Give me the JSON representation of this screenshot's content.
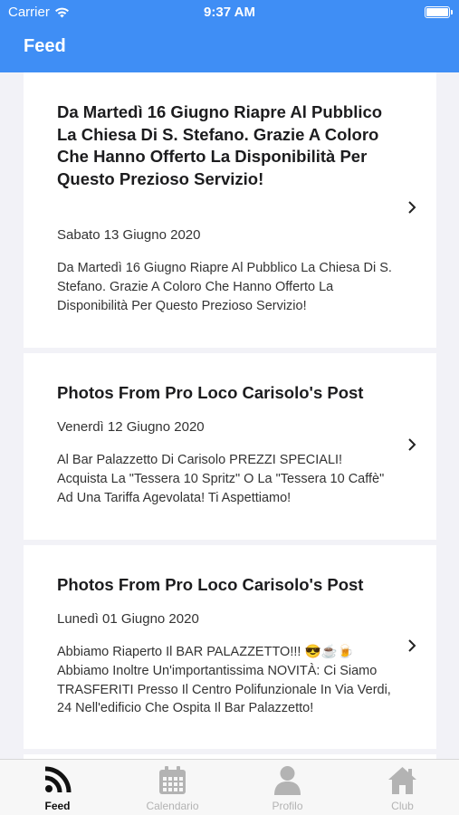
{
  "status_bar": {
    "carrier": "Carrier",
    "time": "9:37 AM"
  },
  "header": {
    "title": "Feed"
  },
  "feed": {
    "items": [
      {
        "title": "Da Martedì 16 Giugno Riapre Al Pubblico La Chiesa Di S. Stefano. Grazie A Coloro Che Hanno Offerto La Disponibilità Per Questo Prezioso Servizio!",
        "date": "Sabato 13 Giugno 2020",
        "text": "Da Martedì 16 Giugno Riapre Al Pubblico La Chiesa Di S. Stefano. Grazie A Coloro Che Hanno Offerto La Disponibilità Per Questo Prezioso Servizio!"
      },
      {
        "title": "Photos From Pro Loco Carisolo's Post",
        "date": "Venerdì 12 Giugno 2020",
        "text": "Al Bar Palazzetto Di Carisolo PREZZI SPECIALI! Acquista La \"Tessera 10 Spritz\" O La \"Tessera 10 Caffè\" Ad Una Tariffa Agevolata! Ti Aspettiamo!"
      },
      {
        "title": "Photos From Pro Loco Carisolo's Post",
        "date": "Lunedì 01 Giugno 2020",
        "text": "Abbiamo Riaperto Il BAR PALAZZETTO!!! 😎☕🍺 Abbiamo Inoltre Un'importantissima NOVITÀ: Ci Siamo TRASFERITI Presso Il Centro Polifunzionale In Via Verdi, 24 Nell'edificio Che Ospita Il Bar Palazzetto!"
      }
    ]
  },
  "tabbar": {
    "tabs": [
      {
        "label": "Feed",
        "icon": "rss-icon",
        "active": true
      },
      {
        "label": "Calendario",
        "icon": "calendar-icon",
        "active": false
      },
      {
        "label": "Profilo",
        "icon": "user-icon",
        "active": false
      },
      {
        "label": "Club",
        "icon": "home-icon",
        "active": false
      }
    ]
  },
  "colors": {
    "accent": "#3f8ef5",
    "tab_active": "#111111",
    "tab_inactive": "#b3b3b3"
  }
}
